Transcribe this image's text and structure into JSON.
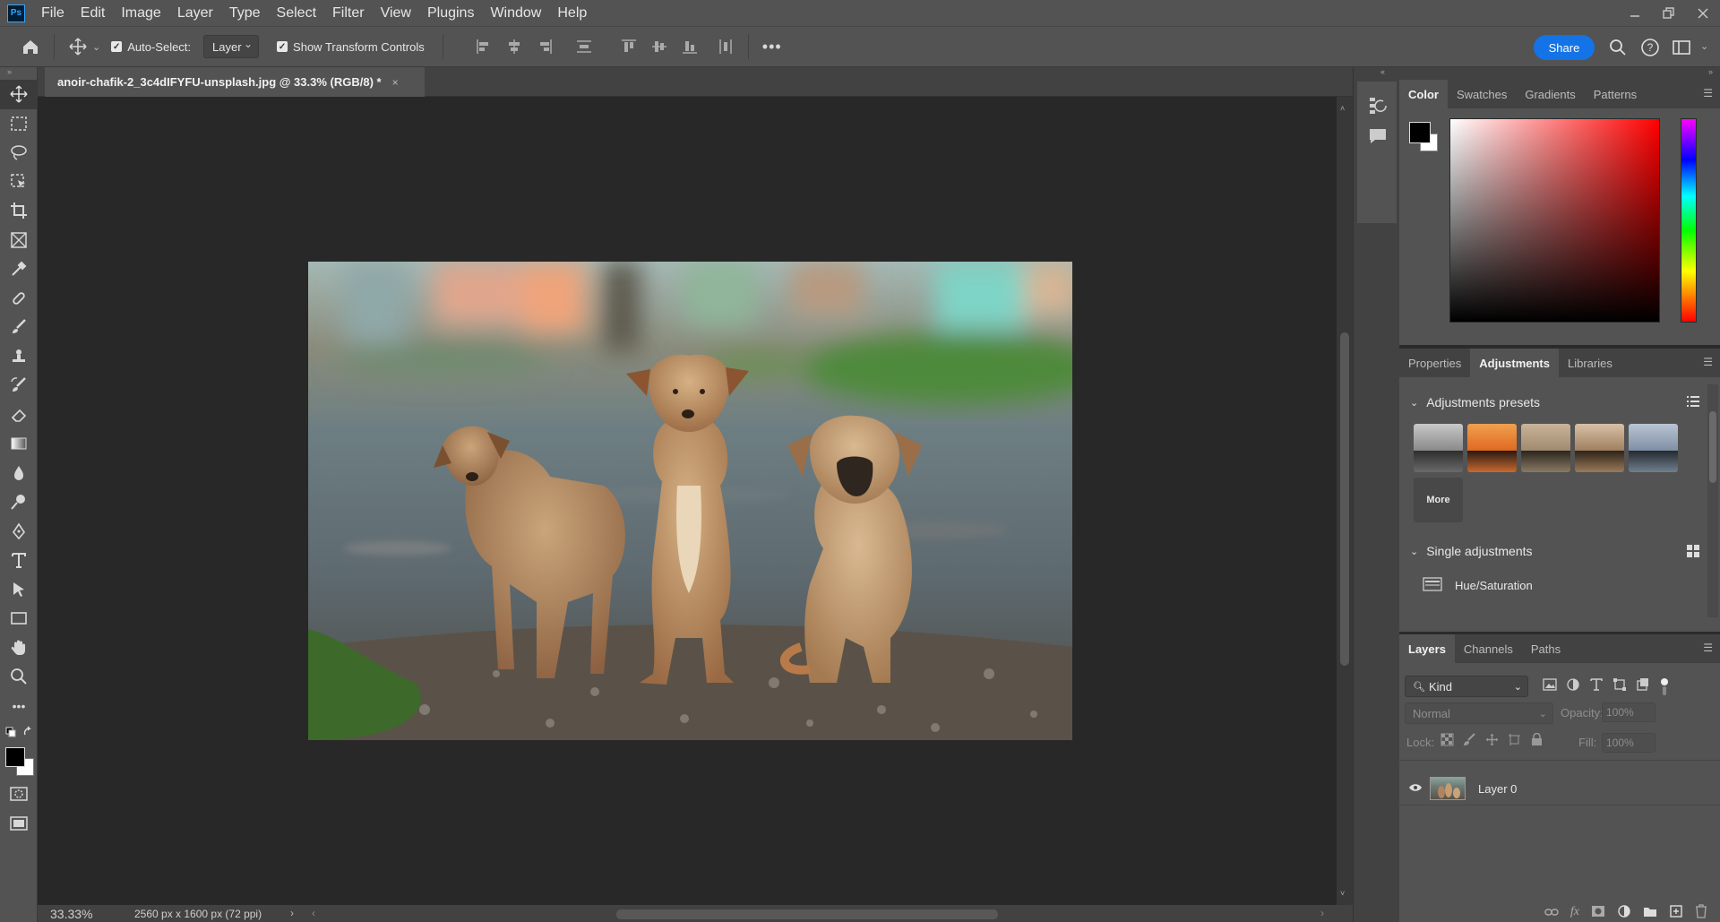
{
  "app": {
    "logo": "Ps"
  },
  "menu": [
    "File",
    "Edit",
    "Image",
    "Layer",
    "Type",
    "Select",
    "Filter",
    "View",
    "Plugins",
    "Window",
    "Help"
  ],
  "options": {
    "auto_select_label": "Auto-Select:",
    "auto_select_value": "Layer",
    "show_transform_label": "Show Transform Controls",
    "share_label": "Share"
  },
  "document": {
    "tab_title": "anoir-chafik-2_3c4dIFYFU-unsplash.jpg @ 33.3% (RGB/8) *",
    "close_glyph": "×"
  },
  "status": {
    "zoom": "33.33%",
    "doc_info": "2560 px x 1600 px (72 ppi)"
  },
  "color_panel": {
    "tabs": [
      "Color",
      "Swatches",
      "Gradients",
      "Patterns"
    ],
    "foreground": "#000000",
    "background": "#ffffff"
  },
  "adjustments_panel": {
    "tabs": [
      "Properties",
      "Adjustments",
      "Libraries"
    ],
    "presets_title": "Adjustments presets",
    "more_label": "More",
    "single_title": "Single adjustments",
    "first_item": "Hue/Saturation"
  },
  "layers_panel": {
    "tabs": [
      "Layers",
      "Channels",
      "Paths"
    ],
    "kind_label": "Kind",
    "blend_mode": "Normal",
    "opacity_label": "Opacity:",
    "opacity_value": "100%",
    "lock_label": "Lock:",
    "fill_label": "Fill:",
    "fill_value": "100%",
    "layers": [
      {
        "name": "Layer 0",
        "visible": true
      }
    ]
  },
  "colors": {
    "accent": "#1473e6",
    "panel_bg": "#535353",
    "canvas_bg": "#282828"
  }
}
